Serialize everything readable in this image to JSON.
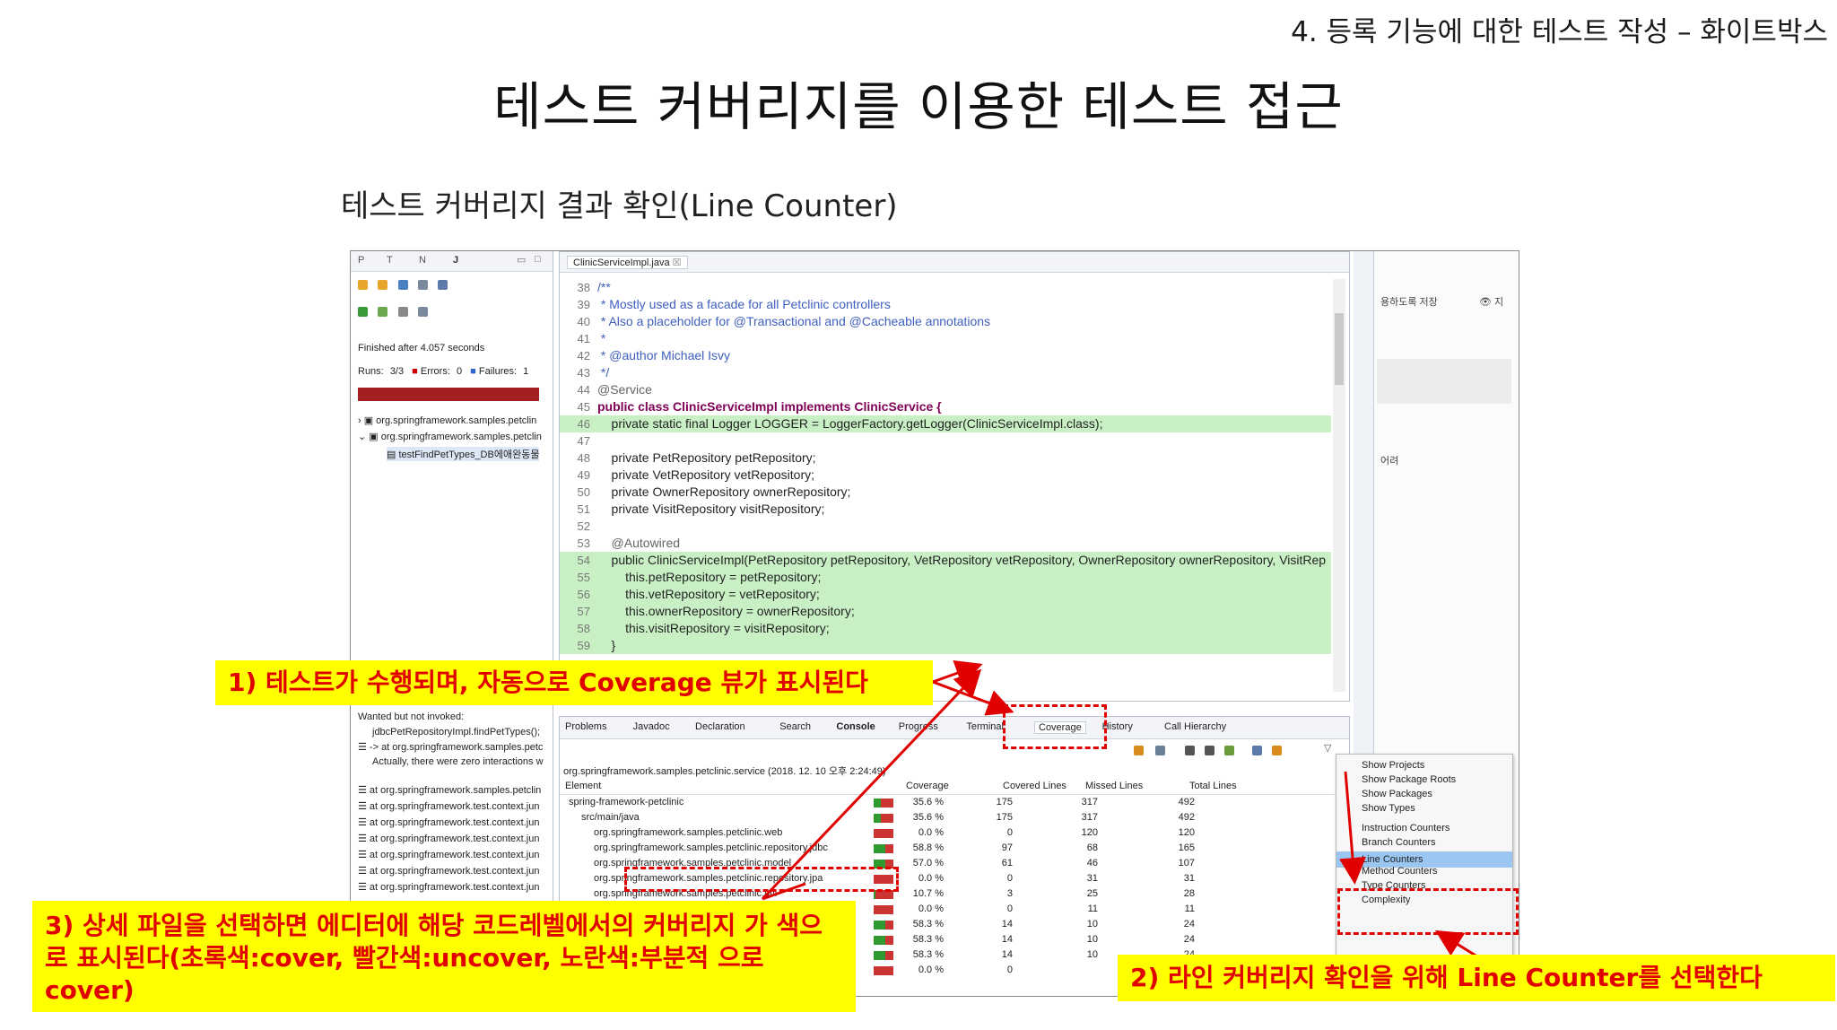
{
  "section_title": "4. 등록 기능에 대한 테스트 작성 – 화이트박스",
  "main_title": "테스트 커버리지를 이용한 테스트 접근",
  "subtitle": "테스트 커버리지 결과 확인(Line Counter)",
  "junit": {
    "tab_labels": [
      "P",
      "T",
      "N",
      "J"
    ],
    "finished": "Finished after 4.057 seconds",
    "runs_label": "Runs:",
    "runs": "3/3",
    "errors_label": "Errors:",
    "errors": "0",
    "failures_label": "Failures:",
    "failures": "1",
    "tree": [
      "org.springframework.samples.petclin",
      "org.springframework.samples.petclin",
      "testFindPetTypes_DB에애완동물"
    ],
    "trace": [
      "Wanted but not invoked:",
      "jdbcPetRepositoryImpl.findPetTypes();",
      "-> at org.springframework.samples.petc",
      "Actually, there were zero interactions w",
      "at org.springframework.samples.petclin",
      "at org.springframework.test.context.jun",
      "at org.springframework.test.context.jun",
      "at org.springframework.test.context.jun",
      "at org.springframework.test.context.jun",
      "at org.springframework.test.context.jun",
      "at org.springframework.test.context.jun"
    ]
  },
  "editor": {
    "tab": "ClinicServiceImpl.java",
    "lines": [
      {
        "n": "38",
        "t": "/**"
      },
      {
        "n": "39",
        "t": " * Mostly used as a facade for all Petclinic controllers"
      },
      {
        "n": "40",
        "t": " * Also a placeholder for @Transactional and @Cacheable annotations"
      },
      {
        "n": "41",
        "t": " *"
      },
      {
        "n": "42",
        "t": " * @author Michael Isvy"
      },
      {
        "n": "43",
        "t": " */"
      },
      {
        "n": "44",
        "t": "@Service"
      },
      {
        "n": "45",
        "t": "public class ClinicServiceImpl implements ClinicService {"
      },
      {
        "n": "46",
        "t": "    private static final Logger LOGGER = LoggerFactory.getLogger(ClinicServiceImpl.class);"
      },
      {
        "n": "47",
        "t": ""
      },
      {
        "n": "48",
        "t": "    private PetRepository petRepository;"
      },
      {
        "n": "49",
        "t": "    private VetRepository vetRepository;"
      },
      {
        "n": "50",
        "t": "    private OwnerRepository ownerRepository;"
      },
      {
        "n": "51",
        "t": "    private VisitRepository visitRepository;"
      },
      {
        "n": "52",
        "t": ""
      },
      {
        "n": "53",
        "t": "    @Autowired"
      },
      {
        "n": "54",
        "t": "    public ClinicServiceImpl(PetRepository petRepository, VetRepository vetRepository, OwnerRepository ownerRepository, VisitRep"
      },
      {
        "n": "55",
        "t": "        this.petRepository = petRepository;"
      },
      {
        "n": "56",
        "t": "        this.vetRepository = vetRepository;"
      },
      {
        "n": "57",
        "t": "        this.ownerRepository = ownerRepository;"
      },
      {
        "n": "58",
        "t": "        this.visitRepository = visitRepository;"
      },
      {
        "n": "59",
        "t": "    }"
      }
    ]
  },
  "bottom_tabs": [
    "Problems",
    "Javadoc",
    "Declaration",
    "Search",
    "Console",
    "Progress",
    "Terminal",
    "Coverage",
    "History",
    "Call Hierarchy"
  ],
  "coverage": {
    "session": "org.springframework.samples.petclinic.service (2018. 12. 10 오후 2:24:49)",
    "headers": [
      "Element",
      "Coverage",
      "Covered Lines",
      "Missed Lines",
      "Total Lines"
    ],
    "rows": [
      {
        "el": "spring-framework-petclinic",
        "cov": "35.6 %",
        "covered": "175",
        "missed": "317",
        "total": "492",
        "pct": 0.356,
        "indent": 0
      },
      {
        "el": "src/main/java",
        "cov": "35.6 %",
        "covered": "175",
        "missed": "317",
        "total": "492",
        "pct": 0.356,
        "indent": 1
      },
      {
        "el": "org.springframework.samples.petclinic.web",
        "cov": "0.0 %",
        "covered": "0",
        "missed": "120",
        "total": "120",
        "pct": 0.0,
        "indent": 2
      },
      {
        "el": "org.springframework.samples.petclinic.repository.jdbc",
        "cov": "58.8 %",
        "covered": "97",
        "missed": "68",
        "total": "165",
        "pct": 0.588,
        "indent": 2
      },
      {
        "el": "org.springframework.samples.petclinic.model",
        "cov": "57.0 %",
        "covered": "61",
        "missed": "46",
        "total": "107",
        "pct": 0.57,
        "indent": 2
      },
      {
        "el": "org.springframework.samples.petclinic.repository.jpa",
        "cov": "0.0 %",
        "covered": "0",
        "missed": "31",
        "total": "31",
        "pct": 0.0,
        "indent": 2
      },
      {
        "el": "org.springframework.samples.petclinic.util",
        "cov": "10.7 %",
        "covered": "3",
        "missed": "25",
        "total": "28",
        "pct": 0.107,
        "indent": 2
      },
      {
        "el": "",
        "cov": "0.0 %",
        "covered": "0",
        "missed": "11",
        "total": "11",
        "pct": 0.0,
        "indent": 2
      },
      {
        "el": "",
        "cov": "58.3 %",
        "covered": "14",
        "missed": "10",
        "total": "24",
        "pct": 0.583,
        "indent": 2
      },
      {
        "el": "",
        "cov": "58.3 %",
        "covered": "14",
        "missed": "10",
        "total": "24",
        "pct": 0.583,
        "indent": 2
      },
      {
        "el": "",
        "cov": "58.3 %",
        "covered": "14",
        "missed": "10",
        "total": "24",
        "pct": 0.583,
        "indent": 2
      },
      {
        "el": "",
        "cov": "0.0 %",
        "covered": "0",
        "missed": "",
        "total": "",
        "pct": 0.0,
        "indent": 2
      }
    ]
  },
  "menu": {
    "items": [
      "Show Projects",
      "Show Package Roots",
      "Show Packages",
      "Show Types",
      "Instruction Counters",
      "Branch Counters",
      "Line Counters",
      "Method Counters",
      "Type Counters",
      "Complexity"
    ],
    "selected": "Line Counters"
  },
  "side_fragments": [
    "용하도록 저장",
    "지",
    "어려"
  ],
  "callouts": {
    "c1": "1) 테스트가 수행되며, 자동으로 Coverage 뷰가 표시된다",
    "c2": "2) 라인 커버리지 확인을 위해 Line Counter를 선택한다",
    "c3": "3) 상세 파일을 선택하면 에디터에 해당 코드레벨에서의 커버리지 가 색으로 표시된다(초록색:cover, 빨간색:uncover, 노란색:부분적 으로cover)"
  },
  "colors": {
    "accent_red": "#e00000",
    "callout_yellow": "#ffff00",
    "covered_green": "#c9f0c5",
    "fail_bar": "#a31e1e"
  }
}
